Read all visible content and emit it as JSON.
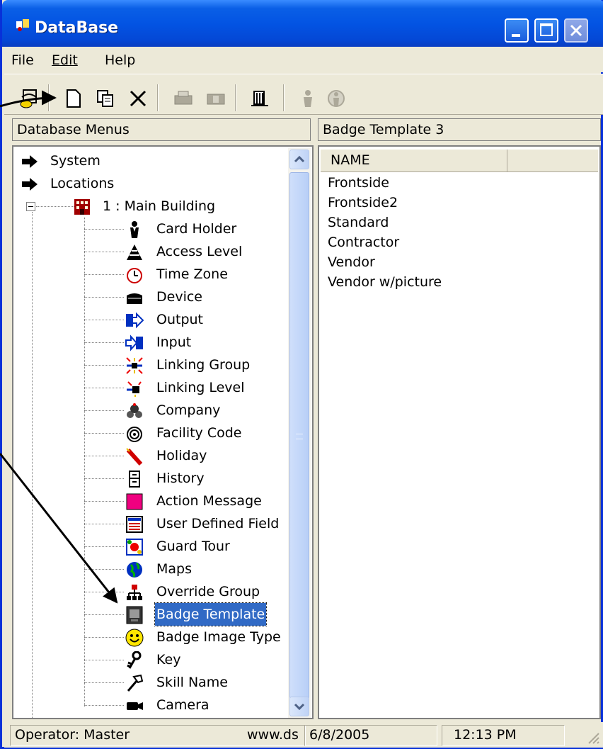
{
  "window": {
    "title": "DataBase",
    "icon": "database-app-icon"
  },
  "titlebar_buttons": [
    "minimize-icon",
    "maximize-icon",
    "close-icon"
  ],
  "menu": {
    "file": "File",
    "edit": "Edit",
    "help": "Help"
  },
  "toolbar": {
    "buttons": [
      "exit-icon",
      "new-icon",
      "copy-icon",
      "delete-icon",
      "print-icon",
      "print-preview-icon",
      "report-icon",
      "card-holder-icon",
      "find-icon"
    ]
  },
  "left_header": "Database Menus",
  "right_header": "Badge Template  3",
  "tree": {
    "system": "System",
    "locations": "Locations",
    "main_building": "1 : Main Building",
    "items": [
      {
        "label": "Card Holder",
        "icon": "card-holder-icon"
      },
      {
        "label": "Access Level",
        "icon": "access-level-icon"
      },
      {
        "label": "Time Zone",
        "icon": "clock-icon"
      },
      {
        "label": "Device",
        "icon": "device-icon"
      },
      {
        "label": "Output",
        "icon": "output-icon"
      },
      {
        "label": "Input",
        "icon": "input-icon"
      },
      {
        "label": "Linking Group",
        "icon": "linking-group-icon"
      },
      {
        "label": "Linking Level",
        "icon": "linking-level-icon"
      },
      {
        "label": "Company",
        "icon": "company-icon"
      },
      {
        "label": "Facility Code",
        "icon": "facility-code-icon"
      },
      {
        "label": "Holiday",
        "icon": "holiday-icon"
      },
      {
        "label": "History",
        "icon": "history-icon"
      },
      {
        "label": "Action Message",
        "icon": "action-message-icon"
      },
      {
        "label": "User Defined Field",
        "icon": "user-defined-field-icon"
      },
      {
        "label": "Guard Tour",
        "icon": "guard-tour-icon"
      },
      {
        "label": "Maps",
        "icon": "globe-icon"
      },
      {
        "label": "Override Group",
        "icon": "override-group-icon"
      },
      {
        "label": "Badge Template",
        "icon": "badge-template-icon"
      },
      {
        "label": "Badge Image Type",
        "icon": "smiley-icon"
      },
      {
        "label": "Key",
        "icon": "key-icon"
      },
      {
        "label": "Skill Name",
        "icon": "hammer-icon"
      },
      {
        "label": "Camera",
        "icon": "camera-icon"
      }
    ],
    "selected_item": "Badge Template"
  },
  "list": {
    "column": "NAME",
    "rows": [
      "Frontside",
      "Frontside2",
      "Standard",
      "Contractor",
      "Vendor",
      "Vendor w/picture"
    ]
  },
  "status": {
    "operator": "Operator:  Master",
    "site": "www.ds",
    "date": "6/8/2005",
    "time": "12:13 PM"
  }
}
